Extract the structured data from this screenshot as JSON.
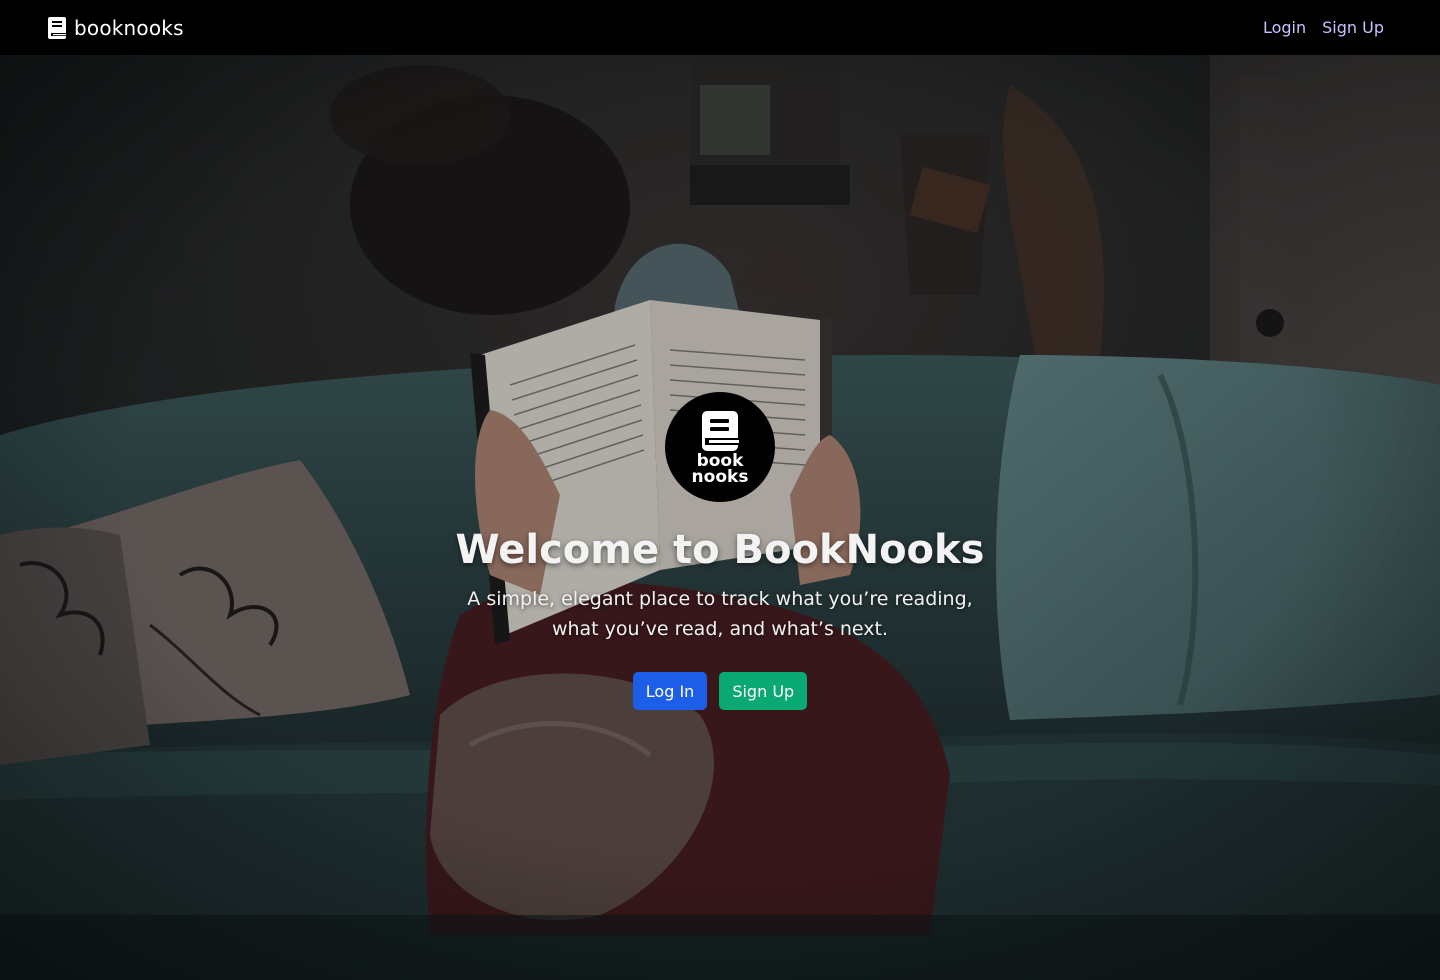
{
  "navbar": {
    "brand": "booknooks",
    "brand_icon": "book-icon",
    "links": {
      "login": "Login",
      "signup": "Sign Up"
    }
  },
  "hero": {
    "logo": {
      "icon": "book-icon",
      "line1": "book",
      "line2": "nooks"
    },
    "title": "Welcome to BookNooks",
    "subtitle": "A simple, elegant place to track what you’re reading, what you’ve read, and what’s next.",
    "buttons": {
      "login": "Log In",
      "signup": "Sign Up"
    }
  },
  "colors": {
    "navbar_bg": "#000000",
    "nav_link": "#c7c3ff",
    "primary_button": "#1c5ee8",
    "success_button": "#0aa872"
  }
}
